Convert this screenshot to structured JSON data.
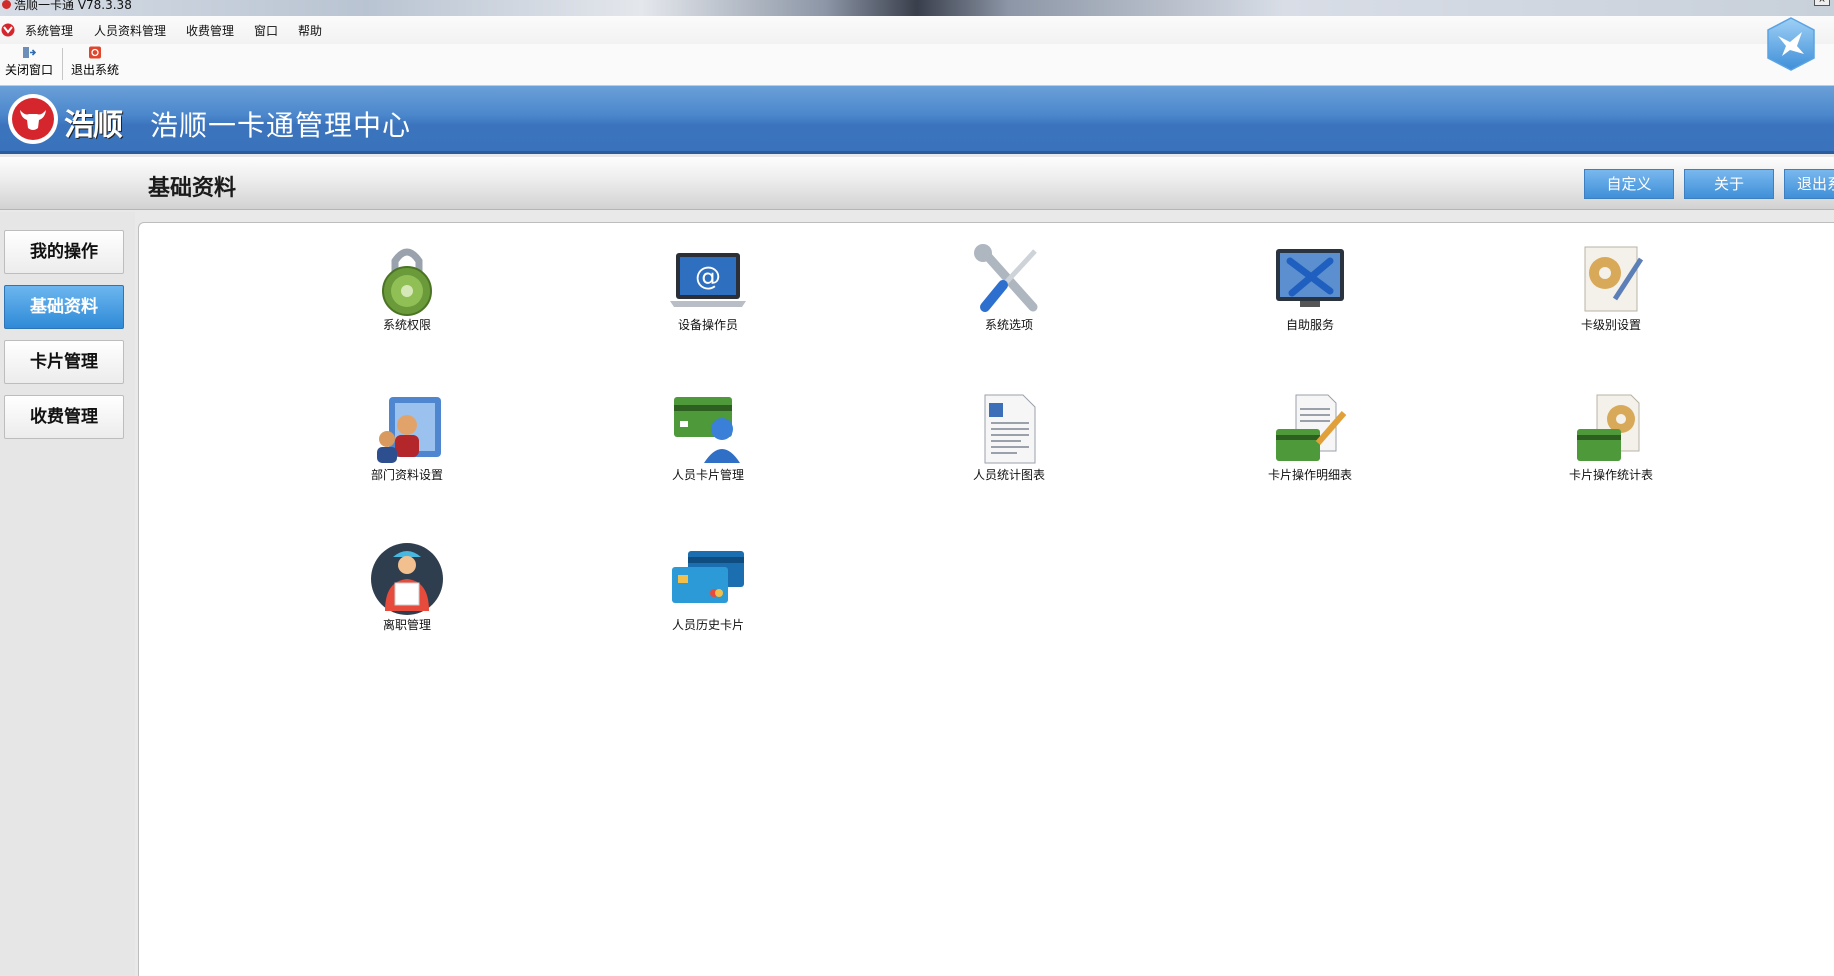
{
  "window": {
    "title": "浩顺一卡通 V78.3.38"
  },
  "menu": {
    "items": [
      "系统管理",
      "人员资料管理",
      "收费管理",
      "窗口",
      "帮助"
    ]
  },
  "toolbar": {
    "close_window": "关闭窗口",
    "exit_system": "退出系统"
  },
  "banner": {
    "brand": "浩顺",
    "title": "浩顺一卡通管理中心"
  },
  "section": {
    "title": "基础资料"
  },
  "header_buttons": {
    "customize": "自定义",
    "about": "关于",
    "exit": "退出系统"
  },
  "sidebar": {
    "items": [
      {
        "label": "我的操作",
        "active": false
      },
      {
        "label": "基础资料",
        "active": true
      },
      {
        "label": "卡片管理",
        "active": false
      },
      {
        "label": "收费管理",
        "active": false
      }
    ]
  },
  "tiles": [
    {
      "label": "系统权限",
      "icon": "padlock-icon"
    },
    {
      "label": "设备操作员",
      "icon": "laptop-at-icon"
    },
    {
      "label": "系统选项",
      "icon": "wrench-screwdriver-icon"
    },
    {
      "label": "自助服务",
      "icon": "monitor-tools-icon"
    },
    {
      "label": "卡级别设置",
      "icon": "document-gear-icon"
    },
    {
      "label": "部门资料设置",
      "icon": "folder-users-icon"
    },
    {
      "label": "人员卡片管理",
      "icon": "card-user-icon"
    },
    {
      "label": "人员统计图表",
      "icon": "report-document-icon"
    },
    {
      "label": "卡片操作明细表",
      "icon": "card-document-pen-icon"
    },
    {
      "label": "卡片操作统计表",
      "icon": "card-document-gear-icon"
    },
    {
      "label": "离职管理",
      "icon": "worker-box-icon"
    },
    {
      "label": "人员历史卡片",
      "icon": "stacked-cards-icon"
    }
  ],
  "colors": {
    "banner_blue": "#3f7dc4",
    "active_blue": "#2f8ad6",
    "brand_red": "#d4262c"
  }
}
